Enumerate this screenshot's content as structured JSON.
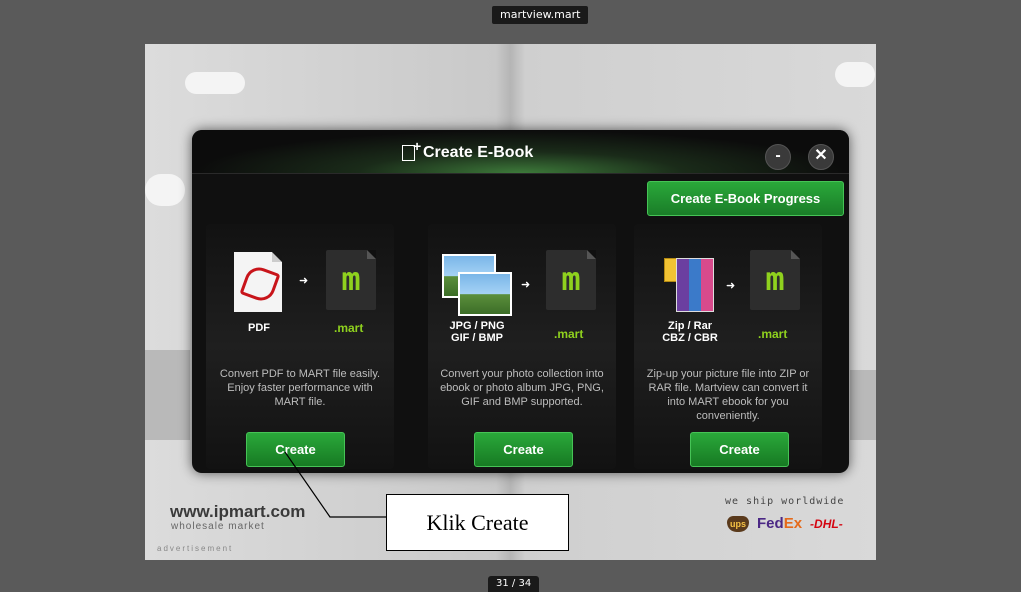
{
  "window_title": "martview.mart",
  "page_counter": "31 / 34",
  "background_ad": {
    "url": "www.ipmart.com",
    "tagline": "wholesale market",
    "label": "advertisement",
    "shipping": "we ship worldwide",
    "carriers": {
      "ups": "ups",
      "fedex_a": "Fed",
      "fedex_b": "Ex",
      "dhl": "-DHL-"
    }
  },
  "dialog": {
    "title": "Create E-Book",
    "minimize_label": "-",
    "close_label": "✕",
    "progress_button": "Create E-Book Progress",
    "panels": [
      {
        "format": "PDF",
        "target": ".mart",
        "description": "Convert PDF to MART file easily. Enjoy faster performance with MART file.",
        "button": "Create"
      },
      {
        "format_line1": "JPG / PNG",
        "format_line2": "GIF / BMP",
        "target": ".mart",
        "description": "Convert your photo collection into ebook or photo album JPG, PNG, GIF and BMP supported.",
        "button": "Create"
      },
      {
        "format_line1": "Zip / Rar",
        "format_line2": "CBZ / CBR",
        "target": ".mart",
        "description": "Zip-up your picture file into ZIP or RAR file. Martview can convert it into MART ebook for you conveniently.",
        "button": "Create"
      }
    ]
  },
  "annotation": {
    "text": "Klik Create"
  },
  "icons": {
    "arrow": "➜",
    "mart_glyph": "m"
  }
}
